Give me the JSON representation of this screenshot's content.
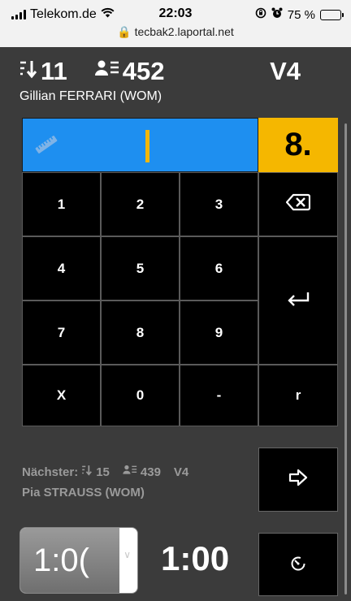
{
  "status_bar": {
    "carrier": "Telekom.de",
    "time": "22:03",
    "battery": "75 %",
    "battery_level": 0.75,
    "url": "tecbak2.laportal.net"
  },
  "header": {
    "order_number": "11",
    "bib_number": "452",
    "round": "V4",
    "athlete": "Gillian FERRARI (WOM)"
  },
  "entry": {
    "value": "",
    "arrow_label": "8."
  },
  "keypad": {
    "keys": [
      "1",
      "2",
      "3",
      "4",
      "5",
      "6",
      "7",
      "8",
      "9",
      "X",
      "0",
      "-",
      "r"
    ],
    "backspace_icon": "backspace-icon",
    "enter_icon": "enter-icon"
  },
  "next": {
    "label": "Nächster:",
    "order_number": "15",
    "bib_number": "439",
    "round": "V4",
    "athlete": "Pia STRAUSS (WOM)"
  },
  "timer": {
    "select_value": "1:0(",
    "display": "1:00"
  },
  "colors": {
    "accent_blue": "#1e8ff0",
    "accent_yellow": "#f5b700",
    "background": "#3b3b3b"
  }
}
